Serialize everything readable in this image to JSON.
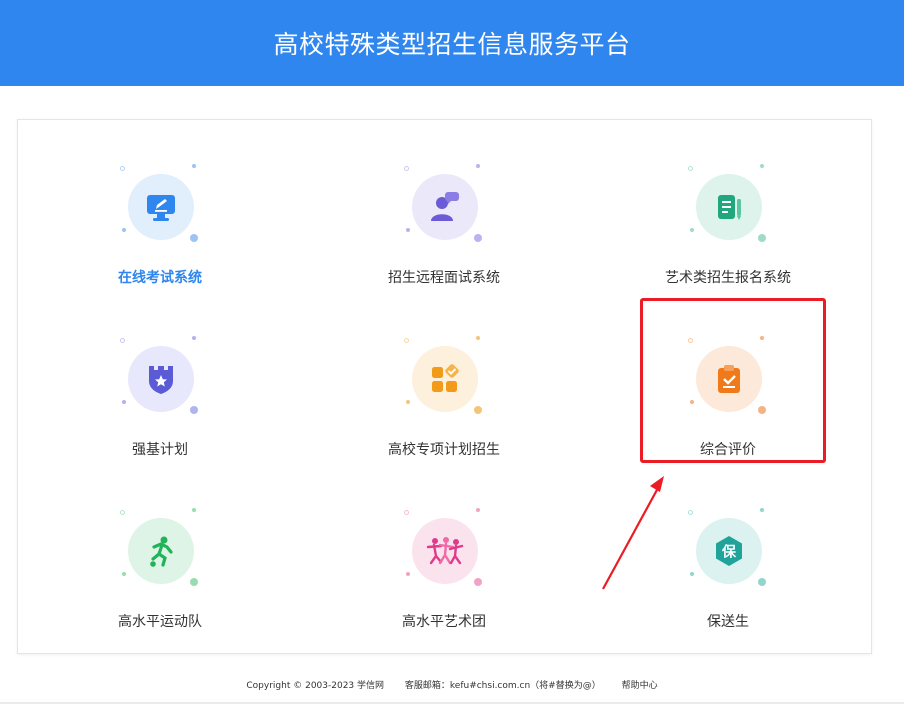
{
  "header": {
    "title": "高校特殊类型招生信息服务平台"
  },
  "tiles": [
    {
      "label": "在线考试系统",
      "icon": "monitor-edit-icon",
      "color": "#2f86ee",
      "bg": "#e1eefc",
      "active": true
    },
    {
      "label": "招生远程面试系统",
      "icon": "interview-person-icon",
      "color": "#6b5bd6",
      "bg": "#ebe8fa"
    },
    {
      "label": "艺术类招生报名系统",
      "icon": "document-pen-icon",
      "color": "#20a77e",
      "bg": "#ddf3ec"
    },
    {
      "label": "强基计划",
      "icon": "shield-star-icon",
      "color": "#5b5bd6",
      "bg": "#e7e8fb"
    },
    {
      "label": "高校专项计划招生",
      "icon": "apps-check-icon",
      "color": "#f29a1a",
      "bg": "#fdf0dc"
    },
    {
      "label": "综合评价",
      "icon": "clipboard-check-icon",
      "color": "#f07a1a",
      "bg": "#fde9da"
    },
    {
      "label": "高水平运动队",
      "icon": "runner-icon",
      "color": "#20b35a",
      "bg": "#def4e6"
    },
    {
      "label": "高水平艺术团",
      "icon": "dancers-icon",
      "color": "#e03b8b",
      "bg": "#fbe3ee"
    },
    {
      "label": "保送生",
      "icon": "bao-badge-icon",
      "color": "#1fa39a",
      "bg": "#dcf2f0"
    }
  ],
  "footer": {
    "copyright": "Copyright © 2003-2023 学信网",
    "email": "客服邮箱：kefu#chsi.com.cn（将#替换为@）",
    "help": "帮助中心"
  },
  "annotation": {
    "highlight_color": "#ec1c24"
  }
}
